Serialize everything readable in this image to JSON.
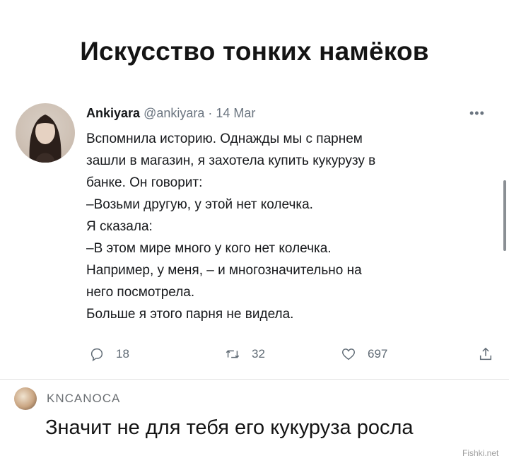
{
  "page": {
    "headline": "Искусство тонких намёков",
    "watermark": "Fishki.net"
  },
  "tweet": {
    "author_name": "Ankiyara",
    "author_handle": "@ankiyara",
    "separator": "·",
    "date": "14 Mar",
    "lines": [
      "Вспомнила историю. Однажды мы с парнем",
      "зашли в магазин, я захотела купить кукурузу в",
      "банке. Он говорит:",
      "–Возьми другую, у этой нет колечка.",
      "Я сказала:",
      "–В этом мире много у кого нет колечка.",
      "Например, у меня, – и многозначительно на",
      "него посмотрела.",
      "Больше я этого парня не видела."
    ],
    "actions": {
      "replies": "18",
      "retweets": "32",
      "likes": "697"
    }
  },
  "comment": {
    "username": "KNCANOCA",
    "text": "Значит не для тебя его кукуруза росла"
  },
  "icons": [
    "more-icon",
    "reply-icon",
    "retweet-icon",
    "like-icon",
    "share-icon"
  ],
  "colors": {
    "text": "#17191c",
    "muted": "#6b7580",
    "background": "#ffffff"
  }
}
